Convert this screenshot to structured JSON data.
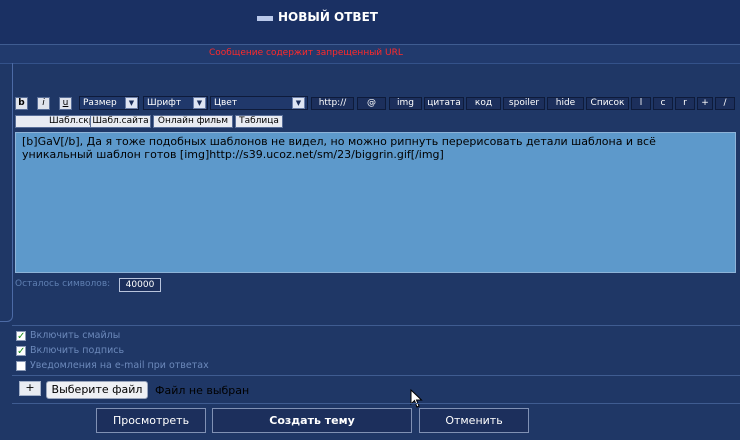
{
  "header": {
    "title": "НОВЫЙ ОТВЕТ"
  },
  "warning": "Сообщение содержит запрещенный URL",
  "toolbar": {
    "bold": "b",
    "italic": "i",
    "underline": "u",
    "size_label": "Размер",
    "font_label": "Шрифт",
    "color_label": "Цвет",
    "http": "http://",
    "at": "@",
    "img": "img",
    "quote": "цитата",
    "code": "код",
    "spoiler": "spoiler",
    "hide": "hide",
    "list": "Список",
    "left": "l",
    "center": "c",
    "right": "r",
    "plus": "+",
    "slash": "/"
  },
  "templates": {
    "script_tpl": "Шабл.скрипта",
    "site_tpl": "Шабл.сайта",
    "movie": "Онлайн фильм",
    "table": "Таблица"
  },
  "message": "[b]GaV[/b], Да я тоже подобных шаблонов не видел, но можно рипнуть перерисовать детали шаблона и всё уникальный шаблон готов [img]http://s39.ucoz.net/sm/23/biggrin.gif[/img]",
  "chars_left": {
    "label": "Осталось символов:",
    "value": "40000"
  },
  "options": [
    {
      "label": "Включить смайлы",
      "checked": true
    },
    {
      "label": "Включить подпись",
      "checked": true
    },
    {
      "label": "Уведомления на e-mail при ответах",
      "checked": false
    }
  ],
  "attach": {
    "plus": "+",
    "choose": "Выберите файл",
    "status": "Файл не выбран"
  },
  "buttons": {
    "preview": "Просмотреть",
    "submit": "Создать тему",
    "cancel": "Отменить"
  }
}
